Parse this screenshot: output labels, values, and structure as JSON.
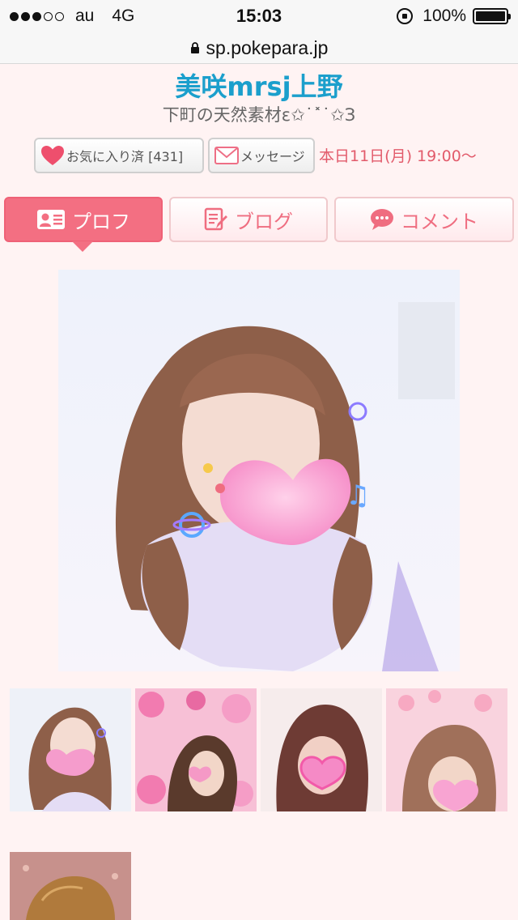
{
  "status_bar": {
    "carrier": "au",
    "network": "4G",
    "time": "15:03",
    "battery": "100%"
  },
  "url_bar": {
    "domain": "sp.pokepara.jp"
  },
  "profile": {
    "name": "美咲mrsj上野",
    "catchphrase": "下町の天然素材ε✩˙˟˙✩З"
  },
  "actions": {
    "favorite_label": "お気に入り済 [431]",
    "message_label": "メッセージ",
    "schedule": "本日11日(月) 19:00〜"
  },
  "tabs": [
    {
      "label": "プロフ",
      "icon": "profile-card-icon",
      "active": true
    },
    {
      "label": "ブログ",
      "icon": "blog-edit-icon",
      "active": false
    },
    {
      "label": "コメント",
      "icon": "comment-bubble-icon",
      "active": false
    }
  ],
  "colors": {
    "background": "#fff3f3",
    "accent_pink": "#f36f82",
    "name_blue": "#1b9fcc",
    "schedule_red": "#e25b6b"
  }
}
